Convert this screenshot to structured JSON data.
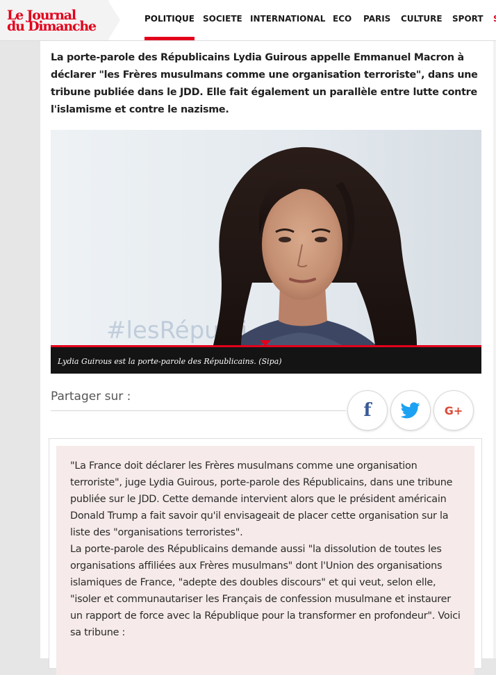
{
  "header": {
    "logo_line1": "Le Journal",
    "logo_line2": "du Dimanche",
    "nav": [
      {
        "label": "POLITIQUE"
      },
      {
        "label": "SOCIETE"
      },
      {
        "label": "INTERNATIONAL"
      },
      {
        "label": "ECO"
      },
      {
        "label": "PARIS"
      },
      {
        "label": "CULTURE"
      },
      {
        "label": "SPORT"
      }
    ],
    "nav_more": "S",
    "active_tab": "POLITIQUE"
  },
  "article": {
    "lead": "La porte-parole des Républicains Lydia Guirous appelle Emmanuel Macron à déclarer \"les Frères musulmans comme une organisation terroriste\", dans une tribune publiée dans le JDD. Elle fait également un parallèle entre lutte contre l'islamisme et contre le nazisme.",
    "photo_caption": "Lydia Guirous est la porte-parole des Républicains. (Sipa)",
    "photo_backdrop_text": "#lesRépubli",
    "share_label": "Partager sur :",
    "share_buttons": {
      "facebook": "f",
      "google_plus": "G+"
    },
    "paragraphs": [
      "\"La France doit déclarer les Frères musulmans comme une organisation terroriste\", juge Lydia Guirous, porte-parole des Républicains, dans une tribune publiée sur le JDD. Cette demande intervient alors que le président américain Donald Trump a fait savoir qu'il envisageait de placer cette organisation sur la liste des \"organisations terroristes\".",
      "La porte-parole des Républicains demande aussi \"la dissolution de toutes les organisations affiliées aux Frères musulmans\" dont l'Union des organisations islamiques de France, \"adepte des doubles discours\" et qui veut, selon elle, \"isoler et communautariser les Français de confession musulmane et instaurer un rapport de force avec la République pour la transformer en profondeur\". Voici sa tribune :"
    ]
  },
  "colors": {
    "brand_red": "#e3001b",
    "facebook_blue": "#3b5998",
    "twitter_blue": "#1da1f2",
    "google_red": "#dd4b39",
    "body_box_bg": "#f6ebea",
    "caption_bg": "#141414"
  },
  "icons": [
    "facebook-icon",
    "twitter-icon",
    "google-plus-icon"
  ]
}
